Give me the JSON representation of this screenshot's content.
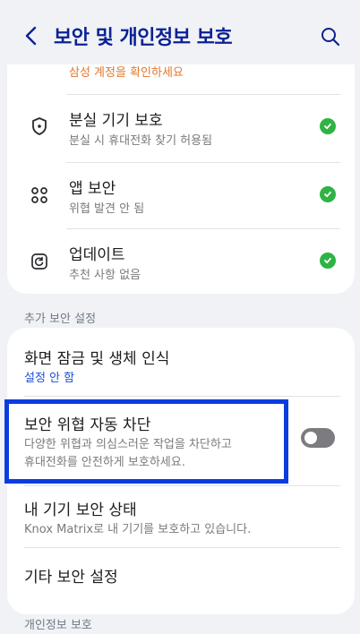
{
  "header": {
    "title": "보안 및 개인정보 보호",
    "back_icon": "chevron-left-icon",
    "search_icon": "search-icon"
  },
  "colors": {
    "title": "#0b2293",
    "warning": "#e3772a",
    "link": "#1a4fd6",
    "check": "#2fb344",
    "highlight": "#0a3de0"
  },
  "card1": {
    "partial_sub": "삼성 계정을 확인하세요",
    "items": [
      {
        "title": "분실 기기 보호",
        "sub": "분실 시 휴대전화 찾기 허용됨",
        "icon": "shield-icon",
        "status": "check-icon"
      },
      {
        "title": "앱 보안",
        "sub": "위협 발견 안 됨",
        "icon": "apps-grid-icon",
        "status": "check-icon"
      },
      {
        "title": "업데이트",
        "sub": "추천 사항 없음",
        "icon": "update-icon",
        "status": "check-icon"
      }
    ]
  },
  "section_extra": "추가 보안 설정",
  "card2": {
    "items": [
      {
        "title": "화면 잠금 및 생체 인식",
        "sub": "설정 안 함"
      },
      {
        "title": "보안 위협 자동 차단",
        "sub1": "다양한 위협과 의심스러운 작업을 차단하고",
        "sub2": "휴대전화를 안전하게 보호하세요.",
        "toggle_on": false
      },
      {
        "title": "내 기기 보안 상태",
        "sub": "Knox Matrix로 내 기기를 보호하고 있습니다."
      },
      {
        "title": "기타 보안 설정"
      }
    ]
  },
  "section_privacy": "개인정보 보호"
}
